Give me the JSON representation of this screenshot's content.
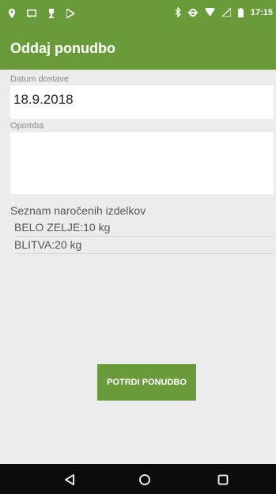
{
  "status_bar": {
    "time": "17:15",
    "left_icons": [
      "location-icon",
      "message-icon",
      "trophy-icon",
      "play-store-icon"
    ],
    "right_icons": [
      "bluetooth-icon",
      "data-sync-icon",
      "wifi-icon",
      "signal-icon",
      "battery-icon"
    ]
  },
  "app_bar": {
    "title": "Oddaj ponudbo"
  },
  "form": {
    "delivery_date_label": "Datum dostave",
    "delivery_date_value": "18.9.2018",
    "note_label": "Opomba",
    "note_value": ""
  },
  "orders": {
    "title": "Seznam naročenih izdelkov",
    "items": [
      {
        "text": "BELO ZELJE:10 kg"
      },
      {
        "text": "BLITVA:20 kg"
      }
    ]
  },
  "actions": {
    "confirm_label": "POTRDI PONUDBO"
  },
  "nav_bar": {
    "buttons": [
      "back-icon",
      "home-icon",
      "recents-icon"
    ]
  },
  "colors": {
    "primary": "#6a9b3a",
    "background": "#ececec",
    "nav_background": "#0c0c0c"
  }
}
